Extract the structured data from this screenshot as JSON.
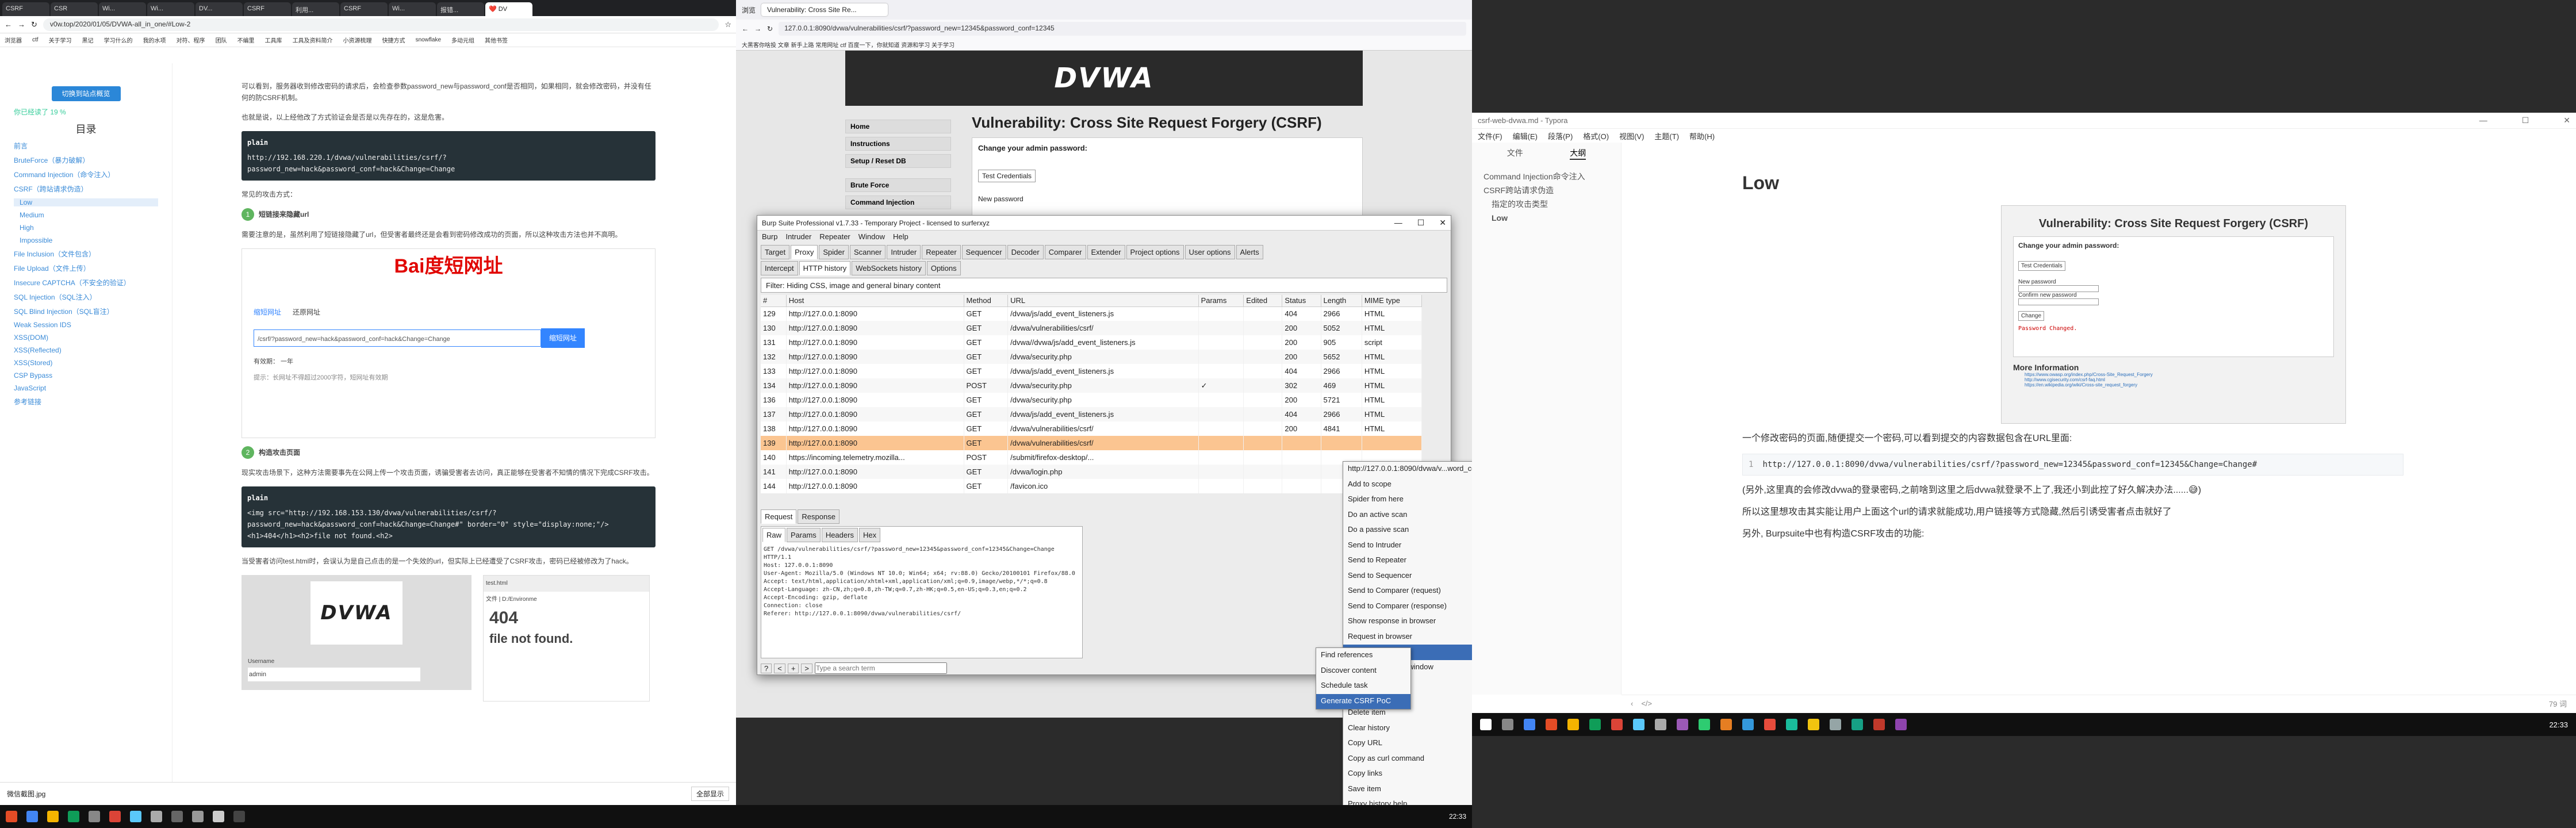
{
  "monitor1": {
    "tabs": [
      "CSRF",
      "CSR",
      "Wi...",
      "Wi...",
      "DV...",
      "CSRF",
      "利用...",
      "CSRF",
      "Wi...",
      "报错...",
      "❤️ DV"
    ],
    "url": "v0w.top/2020/01/05/DVWA-all_in_one/#Low-2",
    "bookmarks": [
      "浏览器",
      "ctf",
      "关于学习",
      "黑记",
      "学习什么的",
      "我的水项",
      "对符、程序",
      "团队",
      "不编里",
      "工具库",
      "工具及资料简介",
      "小资源梳理",
      "快捷方式",
      "snowflake",
      "多动元组",
      "其他书签"
    ],
    "toc": {
      "button": "切换到站点概览",
      "progress": "你已经读了 19 %",
      "title": "目录",
      "items": [
        "前言",
        "BruteForce（暴力破解）",
        "Command Injection（命令注入）",
        "CSRF（跨站请求伪造）",
        "Low",
        "Medium",
        "High",
        "Impossible",
        "File Inclusion（文件包含）",
        "File Upload（文件上传）",
        "Insecure CAPTCHA（不安全的验证）",
        "SQL Injection（SQL注入）",
        "SQL Blind Injection（SQL盲注）",
        "Weak Session IDS",
        "XSS(DOM)",
        "XSS(Reflected)",
        "XSS(Stored)",
        "CSP Bypass",
        "JavaScript",
        "参考链接"
      ]
    },
    "article": {
      "p1": "可以看到，服务器收到修改密码的请求后，会检查参数password_new与password_conf是否相同，如果相同，就会修改密码，并没有任何的防CSRF机制。",
      "p2": "也就是说，以上经他改了方式验证会是否是以先存在的，这是危害。",
      "code1_lang": "plain",
      "code1": "http://192.168.220.1/dvwa/vulnerabilities/csrf/?password_new=hack&password_conf=hack&Change=Change",
      "p3": "常见的攻击方式：",
      "step1": "短链接来隐藏url",
      "step1_text": "需要注意的是，虽然利用了短链接隐藏了url，但受害者最终还是会看到密码修改成功的页面，所以这种攻击方法也并不高明。",
      "baidu_logo": "Bai度短网址",
      "baidu_tab1": "缩短网址",
      "baidu_tab2": "还原网址",
      "baidu_input": "/csrf/?password_new=hack&password_conf=hack&Change=Change",
      "baidu_btn": "缩短网址",
      "baidu_period": "有效期： 一年",
      "baidu_tip": "提示：长网址不得超过2000字符，短网址有效期",
      "step2": "构造攻击页面",
      "step2_text": "现实攻击场景下，这种方法需要事先在公网上传一个攻击页面，诱骗受害者去访问，真正能够在受害者不知情的情况下完成CSRF攻击。",
      "code2_lang": "plain",
      "code2": "<img src=\"http://192.168.153.130/dvwa/vulnerabilities/csrf/?password_new=hack&password_conf=hack&Change=Change#\" border=\"0\" style=\"display:none;\"/><h1>404</h1><h2>file not found.<h2>",
      "p4": "当受害者访问test.html时，会误认为是自己点击的是一个失效的url，但实际上已经遭受了CSRF攻击，密码已经被修改为了hack。",
      "dvwa_user_label": "Username",
      "dvwa_user_value": "admin",
      "tab_title": "test.html",
      "tab_url": "文件 | D:/Environme",
      "page_404": "404",
      "page_nf": "file not found."
    },
    "download": "微信截图.jpg",
    "download_all": "全部显示"
  },
  "monitor2": {
    "ff_tabs": [
      "浏览",
      "Vulnerability: Cross Site Re..."
    ],
    "url": "127.0.0.1:8090/dvwa/vulnerabilities/csrf/?password_new=12345&password_conf=12345",
    "bookmarks": "大黑客你啥投  文章   新手上路   常用网址   ctf   百度一下，你就知道   资源和学习   关于学习",
    "dvwa": {
      "logo": "DVWA",
      "heading": "Vulnerability: Cross Site Request Forgery (CSRF)",
      "change_pw": "Change your admin password:",
      "test_btn": "Test Credentials",
      "new_pw": "New password",
      "menu": [
        "Home",
        "Instructions",
        "Setup / Reset DB",
        "Brute Force",
        "Command Injection"
      ]
    },
    "burp": {
      "title": "Burp Suite Professional v1.7.33 - Temporary Project - licensed to surferxyz",
      "menus": [
        "Burp",
        "Intruder",
        "Repeater",
        "Window",
        "Help"
      ],
      "tabs": [
        "Target",
        "Proxy",
        "Spider",
        "Scanner",
        "Intruder",
        "Repeater",
        "Sequencer",
        "Decoder",
        "Comparer",
        "Extender",
        "Project options",
        "User options",
        "Alerts"
      ],
      "subtabs": [
        "Intercept",
        "HTTP history",
        "WebSockets history",
        "Options"
      ],
      "filter": "Filter: Hiding CSS, image and general binary content",
      "columns": [
        "#",
        "Host",
        "Method",
        "URL",
        "Params",
        "Edited",
        "Status",
        "Length",
        "MIME type"
      ],
      "rows": [
        [
          "129",
          "http://127.0.0.1:8090",
          "GET",
          "/dvwa/js/add_event_listeners.js",
          "",
          "",
          "404",
          "2966",
          "HTML"
        ],
        [
          "130",
          "http://127.0.0.1:8090",
          "GET",
          "/dvwa/vulnerabilities/csrf/",
          "",
          "",
          "200",
          "5052",
          "HTML"
        ],
        [
          "131",
          "http://127.0.0.1:8090",
          "GET",
          "/dvwa//dvwa/js/add_event_listeners.js",
          "",
          "",
          "200",
          "905",
          "script"
        ],
        [
          "132",
          "http://127.0.0.1:8090",
          "GET",
          "/dvwa/security.php",
          "",
          "",
          "200",
          "5652",
          "HTML"
        ],
        [
          "133",
          "http://127.0.0.1:8090",
          "GET",
          "/dvwa/js/add_event_listeners.js",
          "",
          "",
          "404",
          "2966",
          "HTML"
        ],
        [
          "134",
          "http://127.0.0.1:8090",
          "POST",
          "/dvwa/security.php",
          "✓",
          "",
          "302",
          "469",
          "HTML"
        ],
        [
          "136",
          "http://127.0.0.1:8090",
          "GET",
          "/dvwa/security.php",
          "",
          "",
          "200",
          "5721",
          "HTML"
        ],
        [
          "137",
          "http://127.0.0.1:8090",
          "GET",
          "/dvwa/js/add_event_listeners.js",
          "",
          "",
          "404",
          "2966",
          "HTML"
        ],
        [
          "138",
          "http://127.0.0.1:8090",
          "GET",
          "/dvwa/vulnerabilities/csrf/",
          "",
          "",
          "200",
          "4841",
          "HTML"
        ],
        [
          "139",
          "http://127.0.0.1:8090",
          "GET",
          "/dvwa/vulnerabilities/csrf/",
          "",
          "",
          "",
          "",
          ""
        ],
        [
          "140",
          "https://incoming.telemetry.mozilla...",
          "POST",
          "/submit/firefox-desktop/...",
          "",
          "",
          "",
          "",
          ""
        ],
        [
          "141",
          "http://127.0.0.1:8090",
          "GET",
          "/dvwa/login.php",
          "",
          "",
          "",
          "",
          ""
        ],
        [
          "144",
          "http://127.0.0.1:8090",
          "GET",
          "/favicon.ico",
          "",
          "",
          "",
          "",
          ""
        ]
      ],
      "req_tabs": [
        "Request",
        "Response"
      ],
      "raw_tabs": [
        "Raw",
        "Params",
        "Headers",
        "Hex"
      ],
      "raw_lines": [
        "GET /dvwa/vulnerabilities/csrf/?password_new=12345&password_conf=12345&Change=Change HTTP/1.1",
        "Host: 127.0.0.1:8090",
        "User-Agent: Mozilla/5.0 (Windows NT 10.0; Win64; x64; rv:88.0) Gecko/20100101 Firefox/88.0",
        "Accept: text/html,application/xhtml+xml,application/xml;q=0.9,image/webp,*/*;q=0.8",
        "Accept-Language: zh-CN,zh;q=0.8,zh-TW;q=0.7,zh-HK;q=0.5,en-US;q=0.3,en;q=0.2",
        "Accept-Encoding: gzip, deflate",
        "Connection: close",
        "Referer: http://127.0.0.1:8090/dvwa/vulnerabilities/csrf/"
      ],
      "search_placeholder": "Type a search term",
      "search_suffix": "ches"
    },
    "context_menu": [
      {
        "label": "http://127.0.0.1:8090/dvwa/v...word_conf=12345&Change=Change",
        "key": ""
      },
      {
        "label": "Add to scope",
        "key": ""
      },
      {
        "label": "Spider from here",
        "key": ""
      },
      {
        "label": "Do an active scan",
        "key": ""
      },
      {
        "label": "Do a passive scan",
        "key": ""
      },
      {
        "label": "Send to Intruder",
        "key": "Ctrl+I"
      },
      {
        "label": "Send to Repeater",
        "key": "Ctrl+R"
      },
      {
        "label": "Send to Sequencer",
        "key": ""
      },
      {
        "label": "Send to Comparer (request)",
        "key": ""
      },
      {
        "label": "Send to Comparer (response)",
        "key": ""
      },
      {
        "label": "Show response in browser",
        "key": ""
      },
      {
        "label": "Request in browser",
        "key": "▸"
      },
      {
        "label": "Engagement tools",
        "key": "▸"
      },
      {
        "label": "Show new history window",
        "key": ""
      },
      {
        "label": "Add comment",
        "key": ""
      },
      {
        "label": "Highlight",
        "key": "▸"
      },
      {
        "label": "Delete item",
        "key": ""
      },
      {
        "label": "Clear history",
        "key": ""
      },
      {
        "label": "Copy URL",
        "key": ""
      },
      {
        "label": "Copy as curl command",
        "key": ""
      },
      {
        "label": "Copy links",
        "key": ""
      },
      {
        "label": "Save item",
        "key": ""
      },
      {
        "label": "Proxy history help",
        "key": ""
      }
    ],
    "submenu": [
      "Find references",
      "Discover content",
      "Schedule task",
      "Generate CSRF PoC"
    ],
    "clock": "22:33"
  },
  "monitor3": {
    "title": "csrf-web-dvwa.md - Typora",
    "menus": [
      "文件(F)",
      "编辑(E)",
      "段落(P)",
      "格式(O)",
      "视图(V)",
      "主题(T)",
      "帮助(H)"
    ],
    "outline_tabs": [
      "文件",
      "大纲"
    ],
    "outline": [
      "Command Injection命令注入",
      "CSRF跨站请求伪造",
      "指定的攻击类型",
      "Low"
    ],
    "heading": "Low",
    "dvwa_shot": {
      "title": "Vulnerability: Cross Site Request Forgery (CSRF)",
      "change": "Change your admin password:",
      "test": "Test Credentials",
      "new_pw": "New password",
      "confirm": "Confirm new password",
      "btn": "Change",
      "result": "Password Changed.",
      "more": "More Information",
      "links": [
        "https://www.owasp.org/index.php/Cross-Site_Request_Forgery",
        "http://www.cgisecurity.com/csrf-faq.html",
        "https://en.wikipedia.org/wiki/Cross-site_request_forgery"
      ]
    },
    "p1": "一个修改密码的页面,随便提交一个密码,可以看到提交的内容数据包含在URL里面:",
    "code_ln": "1",
    "code": "http://127.0.0.1:8090/dvwa/vulnerabilities/csrf/?password_new=12345&password_conf=12345&Change=Change#",
    "p2": "(另外,这里真的会修改dvwa的登录密码,之前啥到这里之后dvwa就登录不上了,我还小到此控了好久解决办法......😅)",
    "p3": "所以这里想攻击其实能让用户上面这个url的请求就能成功,用户链接等方式隐藏,然后引诱受害者点击就好了",
    "p4": "另外, Burpsuite中也有构造CSRF攻击的功能:",
    "word_count": "79 词",
    "clock": "22:33"
  }
}
